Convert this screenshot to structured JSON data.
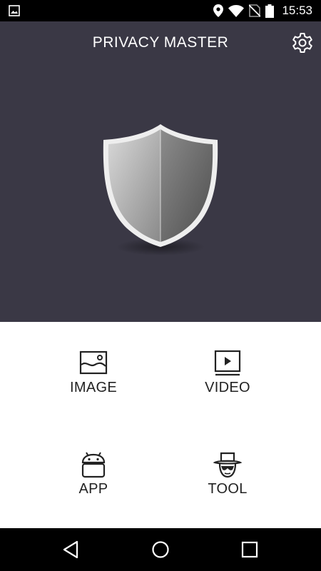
{
  "status_bar": {
    "time": "15:53",
    "icons": [
      "image-notification-icon",
      "location-icon",
      "wifi-icon",
      "no-sim-icon",
      "battery-icon"
    ]
  },
  "header": {
    "title": "PRIVACY MASTER",
    "settings_icon": "gear-icon"
  },
  "hero": {
    "emblem": "shield-icon"
  },
  "menu": {
    "items": [
      {
        "label": "IMAGE",
        "icon": "image-icon"
      },
      {
        "label": "VIDEO",
        "icon": "video-icon"
      },
      {
        "label": "APP",
        "icon": "android-icon"
      },
      {
        "label": "TOOL",
        "icon": "spy-hat-icon"
      }
    ]
  },
  "nav_bar": {
    "buttons": [
      "back-icon",
      "home-icon",
      "recents-icon"
    ]
  },
  "colors": {
    "hero_background": "#3a3845",
    "status_bar": "#000000",
    "nav_bar": "#000000",
    "menu_background": "#ffffff",
    "label_text": "#222222"
  }
}
